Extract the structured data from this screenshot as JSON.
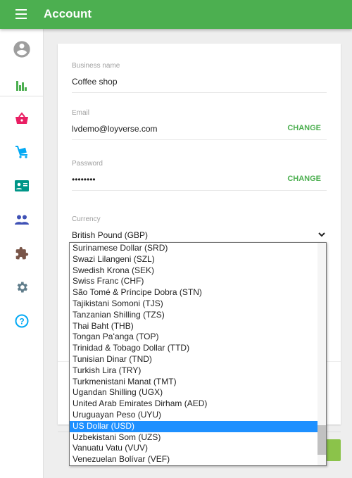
{
  "header": {
    "title": "Account",
    "menu_icon": "hamburger-icon"
  },
  "sidebar": {
    "items": [
      {
        "icon": "account-circle-icon",
        "color": "#9e9e9e"
      },
      {
        "icon": "bar-chart-icon",
        "color": "#4caf50"
      },
      {
        "icon": "basket-icon",
        "color": "#e91e63"
      },
      {
        "icon": "cart-icon",
        "color": "#03a9f4"
      },
      {
        "icon": "id-card-icon",
        "color": "#009688"
      },
      {
        "icon": "people-icon",
        "color": "#3f51b5"
      },
      {
        "icon": "puzzle-icon",
        "color": "#795548"
      },
      {
        "icon": "gear-icon",
        "color": "#607d8b"
      },
      {
        "icon": "help-icon",
        "color": "#03a9f4"
      }
    ]
  },
  "form": {
    "business_name": {
      "label": "Business name",
      "value": "Coffee shop"
    },
    "email": {
      "label": "Email",
      "value": "lvdemo@loyverse.com",
      "action": "CHANGE"
    },
    "password": {
      "label": "Password",
      "value": "••••••••",
      "action": "CHANGE"
    },
    "currency": {
      "label": "Currency",
      "value": "British Pound (GBP)"
    }
  },
  "currency_options": [
    "Surinamese Dollar (SRD)",
    "Swazi Lilangeni (SZL)",
    "Swedish Krona (SEK)",
    "Swiss Franc (CHF)",
    "São Tomé & Príncipe Dobra (STN)",
    "Tajikistani Somoni (TJS)",
    "Tanzanian Shilling (TZS)",
    "Thai Baht (THB)",
    "Tongan Paʻanga (TOP)",
    "Trinidad & Tobago Dollar (TTD)",
    "Tunisian Dinar (TND)",
    "Turkish Lira (TRY)",
    "Turkmenistani Manat (TMT)",
    "Ugandan Shilling (UGX)",
    "United Arab Emirates Dirham (AED)",
    "Uruguayan Peso (UYU)",
    "US Dollar (USD)",
    "Uzbekistani Som (UZS)",
    "Vanuatu Vatu (VUV)",
    "Venezuelan Bolívar (VEF)"
  ],
  "highlighted_option": "US Dollar (USD)",
  "colors": {
    "primary": "#4caf50",
    "highlight": "#1e90ff",
    "save": "#8bc34a"
  }
}
